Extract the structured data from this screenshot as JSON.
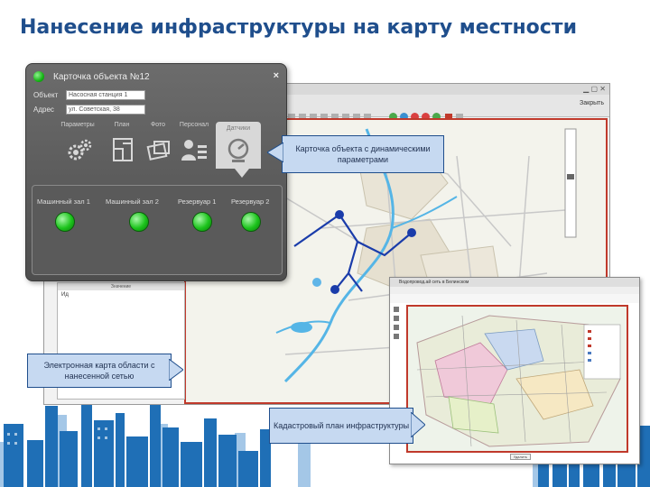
{
  "slide": {
    "title": "Нанесение инфраструктуры на карту местности"
  },
  "card": {
    "title": "Карточка объекта №12",
    "close_glyph": "×",
    "object_label": "Объект",
    "object_value": "Насосная станция 1",
    "address_label": "Адрес",
    "address_value": "ул. Советская, 38",
    "tabs": [
      {
        "label": "Параметры",
        "icon": "gears-icon"
      },
      {
        "label": "План",
        "icon": "floor-plan-icon"
      },
      {
        "label": "Фото",
        "icon": "photo-icon"
      },
      {
        "label": "Персонал",
        "icon": "staff-icon"
      },
      {
        "label": "Датчики",
        "icon": "sensor-gauge-icon",
        "active": true
      }
    ],
    "sensors": [
      {
        "label": "Машинный зал 1",
        "status": "ok"
      },
      {
        "label": "Машинный зал 2",
        "status": "ok"
      },
      {
        "label": "Резервуар 1",
        "status": "ok"
      },
      {
        "label": "Резервуар 2",
        "status": "ok"
      }
    ],
    "status_color": "#1cc41c"
  },
  "map_window": {
    "close_label": "Закрыть",
    "panel_header": "Значение",
    "panel_id_label": "Ид"
  },
  "cadastral_window": {
    "title": "Водопровод.ай сеть в Белинском",
    "bottom_button": "Удалить"
  },
  "callouts": {
    "card": "Карточка объекта с динамическими параметрами",
    "map": "Электронная карта области с нанесенной сетью",
    "cadastral": "Кадастровый план инфраструктуры"
  },
  "colors": {
    "title": "#1f4e8c",
    "callout_fill": "#c6d9f1",
    "network_line": "#1a3caa",
    "map_border": "#c0392b",
    "skyline": "#1f6fb6"
  }
}
